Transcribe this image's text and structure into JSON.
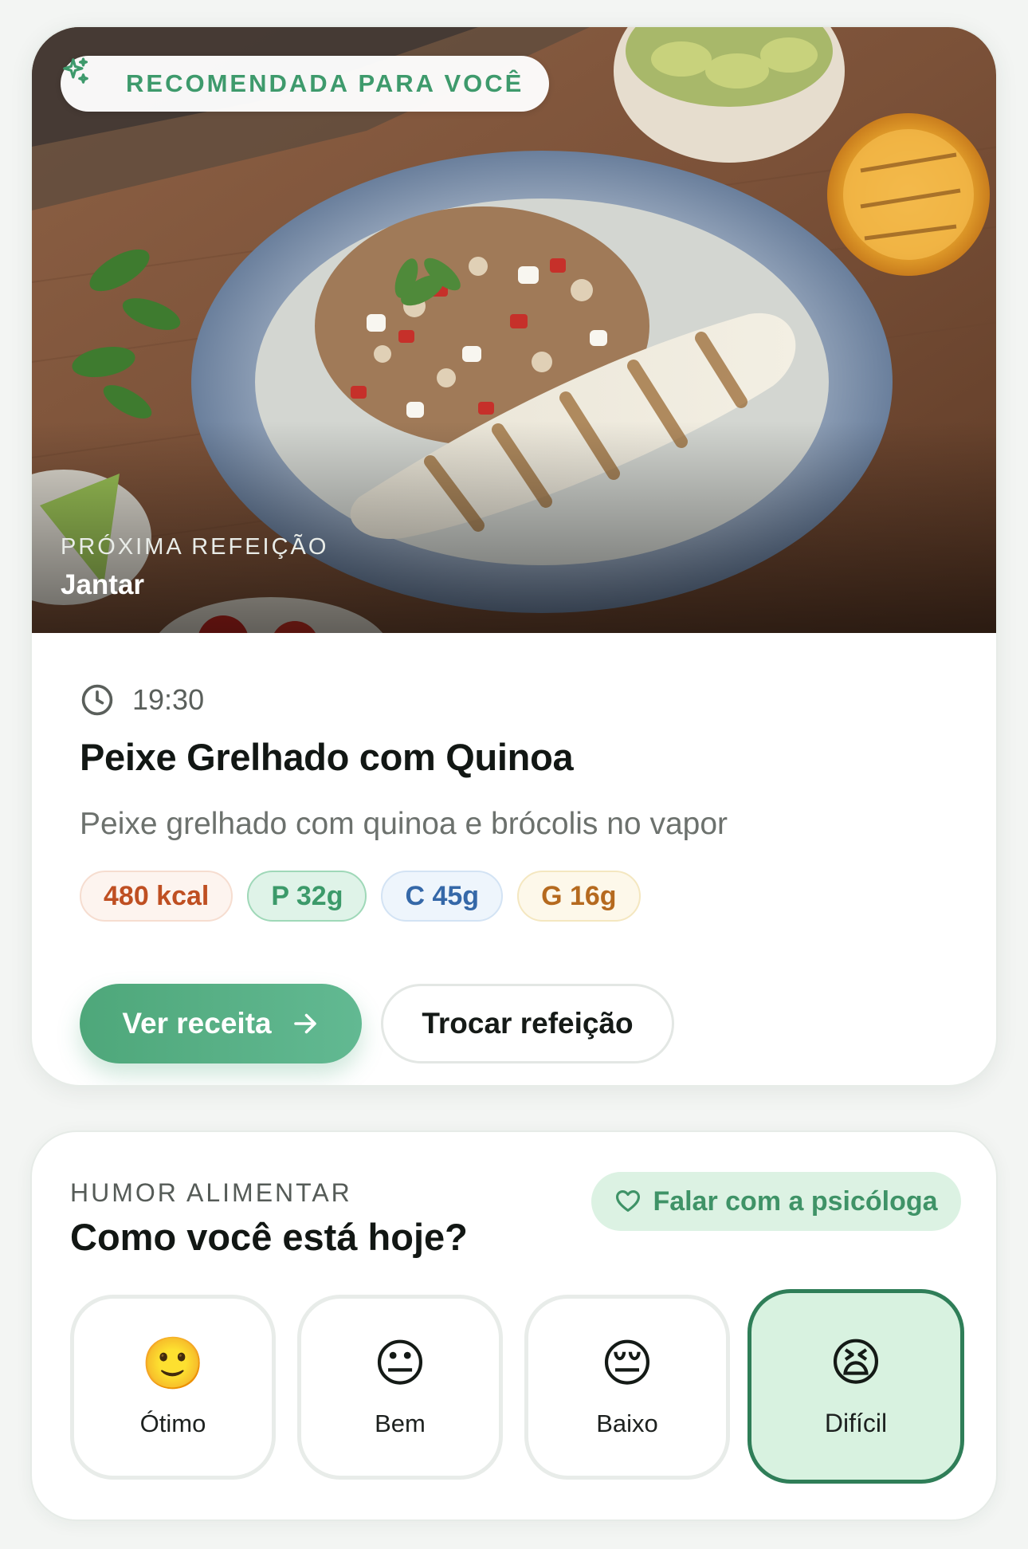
{
  "next_meal": {
    "badge": "RECOMENDADA PARA VOCÊ",
    "label": "PRÓXIMA REFEIÇÃO",
    "meal_type": "Jantar",
    "time": "19:30",
    "title": "Peixe Grelhado com Quinoa",
    "description": "Peixe grelhado com quinoa e brócolis no vapor",
    "macros": {
      "kcal": "480 kcal",
      "protein": "P 32g",
      "carbs": "C 45g",
      "fat": "G 16g"
    },
    "primary_button": "Ver receita",
    "secondary_button": "Trocar refeição"
  },
  "mood": {
    "kicker": "HUMOR ALIMENTAR",
    "title": "Como você está hoje?",
    "psychologist_button": "Falar com a psicóloga",
    "options": [
      {
        "emoji": "🙂",
        "label": "Ótimo",
        "selected": false
      },
      {
        "emoji": "😐",
        "label": "Bem",
        "selected": false
      },
      {
        "emoji": "😔",
        "label": "Baixo",
        "selected": false
      },
      {
        "emoji": "😫",
        "label": "Difícil",
        "selected": true
      }
    ]
  },
  "colors": {
    "accent": "#4ea77a",
    "accent_dark": "#2f7e58",
    "selected_bg": "#d8f2e0"
  },
  "icons": {
    "badge": "sparkles-icon",
    "time": "clock-icon",
    "primary_button": "arrow-right-icon",
    "psychologist": "heart-icon"
  }
}
